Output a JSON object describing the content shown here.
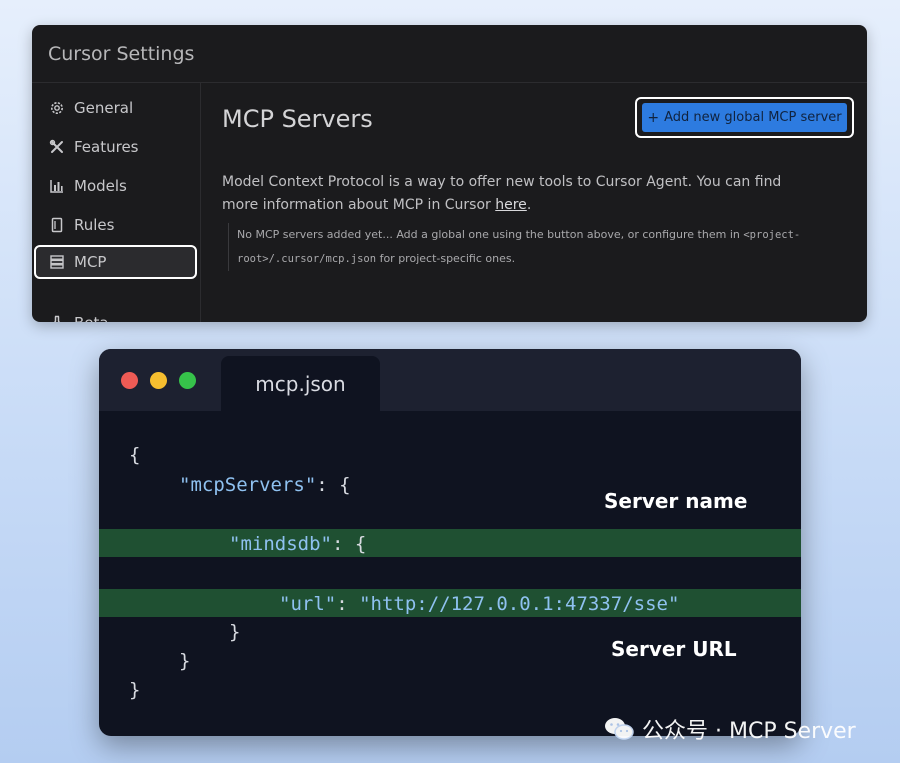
{
  "settings": {
    "title": "Cursor Settings",
    "sidebar": [
      {
        "label": "General",
        "icon": "gear-icon"
      },
      {
        "label": "Features",
        "icon": "tools-icon"
      },
      {
        "label": "Models",
        "icon": "bar-chart-icon"
      },
      {
        "label": "Rules",
        "icon": "book-icon"
      },
      {
        "label": "MCP",
        "icon": "server-stack-icon",
        "active": true
      },
      {
        "label": "Beta",
        "icon": "flask-icon"
      }
    ],
    "main": {
      "title": "MCP Servers",
      "add_button": "Add new global MCP server",
      "add_button_plus": "+",
      "description": "Model Context Protocol is a way to offer new tools to Cursor Agent. You can find more information about MCP in Cursor",
      "description_link": "here",
      "description_end": ".",
      "notice_text": "No MCP servers added yet... Add a global one using the button above, or configure them in",
      "notice_path_1": "<project-",
      "notice_path_2": "root>/.cursor/mcp.json",
      "notice_end": "for project-specific ones."
    },
    "accent_color": "#2d7be0"
  },
  "editor": {
    "tab": "mcp.json",
    "window_dots": [
      "#ee5b55",
      "#f6be2f",
      "#36c24a"
    ],
    "code": {
      "open_brace": "{",
      "servers_key": "\"mcpServers\"",
      "colon_brace": ": {",
      "server_key": "\"mindsdb\"",
      "url_key": "\"url\"",
      "colon": ": ",
      "url_value": "\"http://127.0.0.1:47337/sse\"",
      "close_inner": "}",
      "close_mid": "}",
      "close_outer": "}"
    },
    "annotations": {
      "server_name": "Server name",
      "server_url": "Server URL"
    },
    "highlight_color": "#1f5032"
  },
  "watermark": {
    "text": "公众号 · MCP Server",
    "icon": "wechat-icon"
  }
}
